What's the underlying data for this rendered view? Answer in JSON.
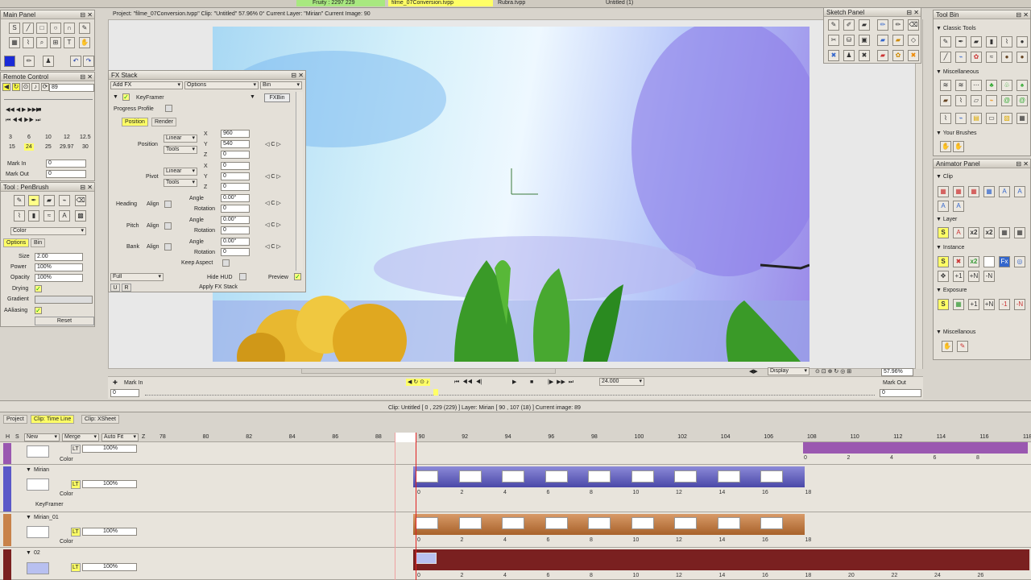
{
  "top": {
    "tab1": "Fruity : 2297 229",
    "tab2": "filme_07Conversion.tvpp",
    "tab3": "Rubra.tvpp",
    "tab4": "Untitled (1)",
    "project_info": "Project: \"filme_07Conversion.tvpp\"  Clip: \"Untitled\"   57.96%  0°  Current Layer: \"Mirian\"  Current Image: 90"
  },
  "main_panel": {
    "title": "Main Panel"
  },
  "remote": {
    "title": "Remote Control",
    "frame_value": "89",
    "fps_row1": [
      "3",
      "6",
      "10",
      "12",
      "12.5"
    ],
    "fps_row2": [
      "15",
      "24",
      "25",
      "29.97",
      "30"
    ],
    "mark_in_label": "Mark In",
    "mark_in_value": "0",
    "mark_out_label": "Mark Out",
    "mark_out_value": "0"
  },
  "tool": {
    "title": "Tool : PenBrush",
    "color_select": "Color",
    "tab_options": "Options",
    "tab_bin": "Bin",
    "size_label": "Size",
    "size_value": "2.00",
    "power_label": "Power",
    "power_value": "100%",
    "opacity_label": "Opacity",
    "opacity_value": "100%",
    "drying_label": "Drying",
    "gradient_label": "Gradient",
    "aaliasing_label": "AAliasing",
    "reset_label": "Reset"
  },
  "fx": {
    "title": "FX Stack",
    "add_fx": "Add FX",
    "options": "Options",
    "bin": "Bin",
    "keyframer": "KeyFramer",
    "fxbin": "FXBin",
    "progress_profile": "Progress Profile",
    "tab_position": "Position",
    "tab_render": "Render",
    "position_label": "Position",
    "pivot_label": "Pivot",
    "heading_label": "Heading",
    "pitch_label": "Pitch",
    "bank_label": "Bank",
    "align_label": "Align",
    "linear": "Linear",
    "tools": "Tools",
    "x_label": "X",
    "y_label": "Y",
    "z_label": "Z",
    "pos_x": "960",
    "pos_y": "540",
    "pos_z": "0",
    "piv_x": "0",
    "piv_y": "0",
    "piv_z": "0",
    "angle_label": "Angle",
    "rotation_label": "Rotation",
    "angle_value": "0.00°",
    "rotation_value": "0",
    "c_label": "C",
    "keep_aspect": "Keep Aspect",
    "full": "Full",
    "hide_hud": "Hide HUD",
    "preview": "Preview",
    "u": "U",
    "r": "R",
    "apply": "Apply FX Stack"
  },
  "sketch": {
    "title": "Sketch Panel"
  },
  "toolbin": {
    "title": "Tool Bin",
    "classic": "Classic Tools",
    "misc": "Miscellaneous",
    "your_brushes": "Your Brushes"
  },
  "animator": {
    "title": "Animator Panel",
    "clip": "Clip",
    "layer": "Layer",
    "instance": "Instance",
    "exposure": "Exposure",
    "misc": "Miscellanous",
    "x2": "x2",
    "plus1": "+1",
    "plusn": "+N",
    "minus1": "-1",
    "minusn": "-N",
    "s": "S"
  },
  "viewer": {
    "mark_in": "Mark In",
    "mark_out": "Mark Out",
    "fps": "24.000",
    "display": "Display",
    "zoom": "57.96%",
    "start": "0",
    "end": "0"
  },
  "timeline": {
    "tab_project": "Project",
    "tab_timeline": "Clip: Time Line",
    "tab_xsheet": "Clip: XSheet",
    "info": "Clip: Untitled [ 0 , 229 (229) ]     Layer: Mirian [ 90 , 107 (18) ]     Current image: 89",
    "hdr_h": "H",
    "hdr_s": "S",
    "hdr_new": "New",
    "hdr_merge": "Merge",
    "hdr_autofit": "Auto Fit",
    "hdr_z": "Z",
    "ruler": [
      "78",
      "80",
      "82",
      "84",
      "86",
      "88",
      "90",
      "92",
      "94",
      "96",
      "98",
      "100",
      "102",
      "104",
      "106",
      "108",
      "110",
      "112",
      "114",
      "116",
      "118"
    ],
    "layers": [
      {
        "name": "",
        "opacity": "100%",
        "mode": "Color",
        "lt": "LT"
      },
      {
        "name": "Mirian",
        "opacity": "100%",
        "mode": "Color",
        "fx": "KeyFramer",
        "lt": "LT"
      },
      {
        "name": "Mirian_01",
        "opacity": "100%",
        "mode": "Color",
        "lt": "LT"
      },
      {
        "name": "02",
        "opacity": "100%",
        "mode": "Color",
        "lt": "LT"
      }
    ],
    "seq_nums": [
      "0",
      "2",
      "4",
      "6",
      "8",
      "10",
      "12",
      "14",
      "16",
      "18"
    ],
    "top_nums": [
      "0",
      "2",
      "4",
      "6",
      "8"
    ],
    "bottom_nums": [
      "0",
      "2",
      "4",
      "6",
      "8",
      "10",
      "12",
      "14",
      "16",
      "18",
      "20",
      "22",
      "24",
      "26"
    ]
  },
  "colors": {
    "accent_yellow": "#ffff66",
    "track_blue": "#6a6ac8",
    "track_orange": "#c8824a",
    "track_red": "#7a2020",
    "track_purple": "#9a58b0"
  }
}
